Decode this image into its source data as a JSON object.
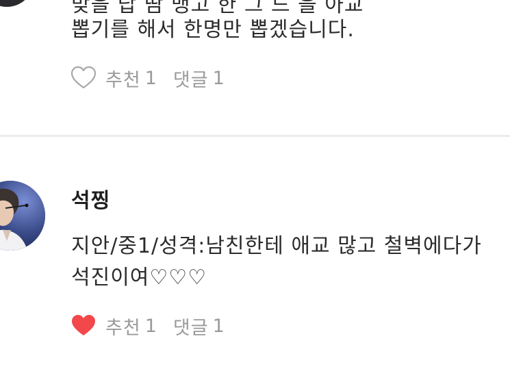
{
  "previous_comment": {
    "text_line_cut": "맞을   답   땀   맹고 한 그  드 을  아교",
    "text_line": "뽑기를 해서 한명만 뽑겠습니다.",
    "like_label": "추천",
    "like_count": "1",
    "reply_label": "댓글",
    "reply_count": "1",
    "liked": false
  },
  "comment": {
    "username": "석찡",
    "text_line_1": "지안/중1/성격:남친한테 애교 많고 철벽에다가",
    "text_line_2": "석진이여♡♡♡",
    "like_label": "추천",
    "like_count": "1",
    "reply_label": "댓글",
    "reply_count": "1",
    "liked": true
  },
  "colors": {
    "heart_liked": "#f2484b",
    "heart_outline": "#a8a8a8",
    "meta_text": "#9a9a9a",
    "divider": "#ececec"
  }
}
